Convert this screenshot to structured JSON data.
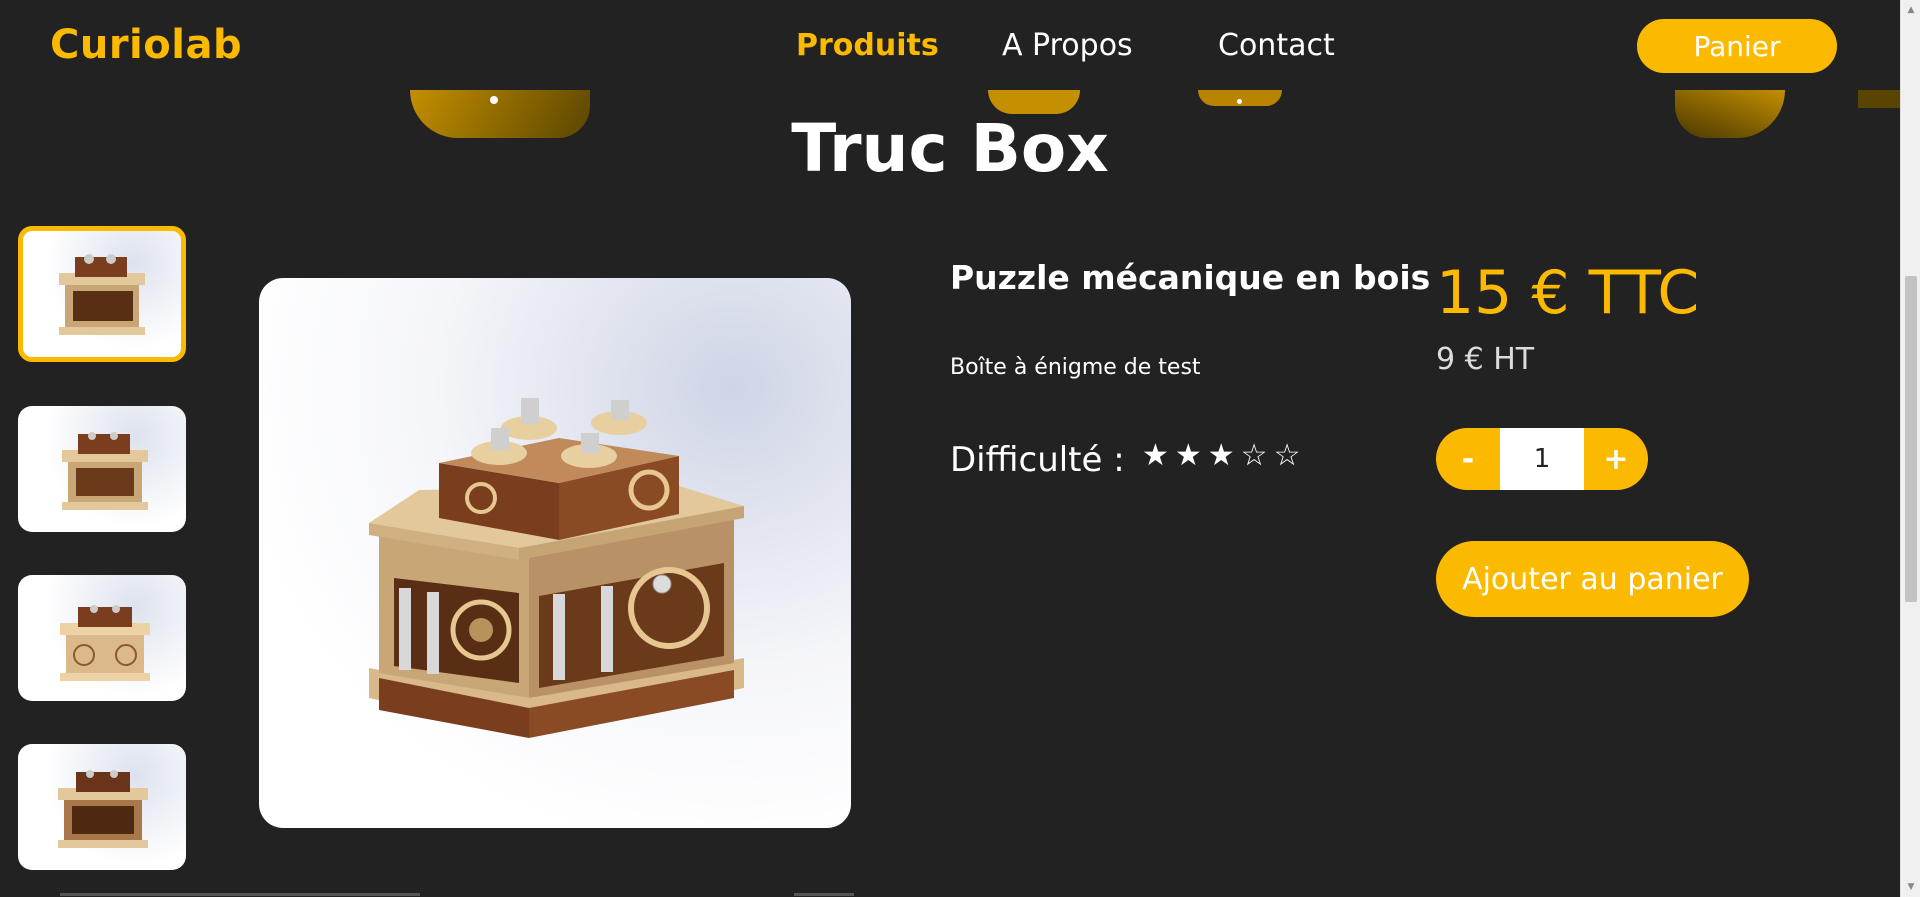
{
  "brand": {
    "name": "Curiolab",
    "accent": "#FBB900",
    "background": "#222222"
  },
  "nav": {
    "items": [
      {
        "label": "Produits",
        "active": true
      },
      {
        "label": "A Propos",
        "active": false
      },
      {
        "label": "Contact",
        "active": false
      }
    ],
    "cart_label": "Panier"
  },
  "product": {
    "title": "Truc Box",
    "subtitle": "Puzzle mécanique en bois",
    "description": "Boîte à énigme de test",
    "difficulty_label": "Difficulté :",
    "difficulty_rating": 3,
    "difficulty_max": 5,
    "difficulty_stars": "★★★☆☆",
    "price_ttc": "15 € TTC",
    "price_ht": "9 € HT",
    "quantity": "1",
    "minus_label": "-",
    "plus_label": "+",
    "add_to_cart_label": "Ajouter au panier",
    "thumbnails": [
      {
        "selected": true
      },
      {
        "selected": false
      },
      {
        "selected": false
      },
      {
        "selected": false
      }
    ]
  }
}
